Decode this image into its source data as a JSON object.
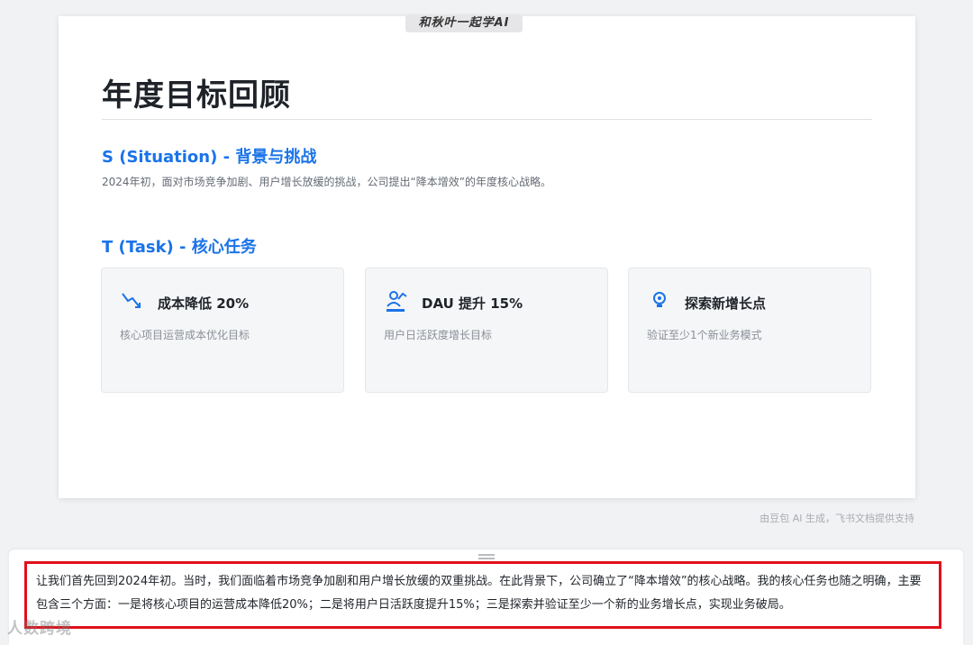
{
  "watermark_top": "和秋叶一起学AI",
  "slide": {
    "title": "年度目标回顾",
    "situation": {
      "heading": "S (Situation) - 背景与挑战",
      "text": "2024年初，面对市场竞争加剧、用户增长放缓的挑战，公司提出“降本增效”的年度核心战略。"
    },
    "task": {
      "heading": "T (Task) - 核心任务",
      "cards": [
        {
          "icon": "trend-down-icon",
          "title": "成本降低 20%",
          "desc": "核心项目运营成本优化目标"
        },
        {
          "icon": "user-growth-icon",
          "title": "DAU 提升 15%",
          "desc": "用户日活跃度增长目标"
        },
        {
          "icon": "idea-icon",
          "title": "探索新增长点",
          "desc": "验证至少1个新业务模式"
        }
      ]
    }
  },
  "footer_note": "由豆包 AI 生成，飞书文档提供支持",
  "subtitle": "让我们首先回到2024年初。当时，我们面临着市场竞争加剧和用户增长放缓的双重挑战。在此背景下，公司确立了“降本增效”的核心战略。我的核心任务也随之明确，主要包含三个方面：一是将核心项目的运营成本降低20%；二是将用户日活跃度提升15%；三是探索并验证至少一个新的业务增长点，实现业务破局。",
  "watermark_bottom": "人数跨境",
  "colors": {
    "accent": "#1a73e8",
    "highlight_border": "#e0101b"
  }
}
